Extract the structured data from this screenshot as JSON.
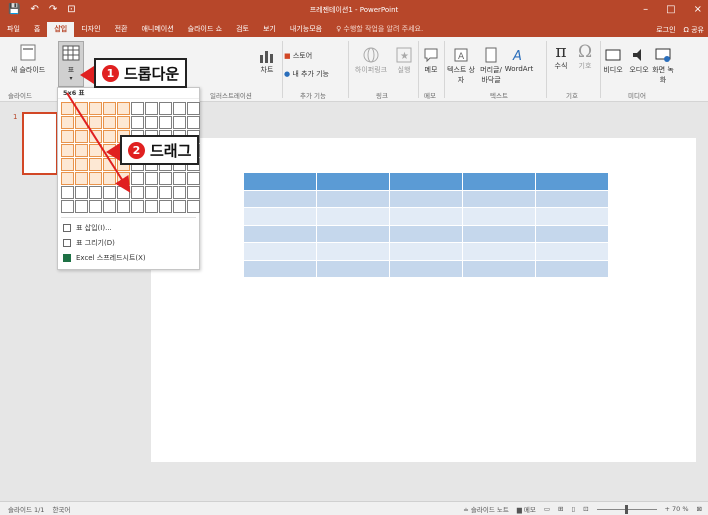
{
  "window": {
    "title": "프레젠테이션1 - PowerPoint",
    "min": "–",
    "max": "□",
    "close": "×"
  },
  "qat": [
    "💾",
    "↶",
    "↷",
    "⊡"
  ],
  "tabs": [
    {
      "label": "파일",
      "active": false
    },
    {
      "label": "홈",
      "active": false
    },
    {
      "label": "삽입",
      "active": true
    },
    {
      "label": "디자인",
      "active": false
    },
    {
      "label": "전환",
      "active": false
    },
    {
      "label": "애니메이션",
      "active": false
    },
    {
      "label": "슬라이드 쇼",
      "active": false
    },
    {
      "label": "검토",
      "active": false
    },
    {
      "label": "보기",
      "active": false
    },
    {
      "label": "내기능모음",
      "active": false
    }
  ],
  "tell_me": "♀ 수행할 작업을 알려 주세요.",
  "account": {
    "login": "로그인",
    "share": "Ω 공유"
  },
  "ribbon": {
    "new_slide": "새 슬라이드",
    "table": "표",
    "chart": "차트",
    "store": "스토어",
    "my_addins": "내 추가 기능",
    "hyperlink": "하이퍼링크",
    "action": "실행",
    "memo": "메모",
    "textbox": "텍스트 상자",
    "header_footer": "머리글/ 바닥글",
    "wordart": "WordArt",
    "equation": "수식",
    "symbol": "기호",
    "video": "비디오",
    "audio": "오디오",
    "screen_record": "화면 녹화",
    "groups": {
      "slide": "슬라이드",
      "illust": "일러스트레이션",
      "addins": "추가 기능",
      "links": "링크",
      "memo": "메모",
      "text": "텍스트",
      "symbols": "기호",
      "media": "미디어"
    }
  },
  "dropdown": {
    "header": "5x6 표",
    "insert_table": "표 삽입(I)...",
    "draw_table": "표 그리기(D)",
    "excel_sheet": "Excel 스프레드시트(X)"
  },
  "callouts": {
    "one": {
      "num": "1",
      "text": "드롭다운"
    },
    "two": {
      "num": "2",
      "text": "드래그"
    }
  },
  "slide_panel": {
    "number": "1"
  },
  "status": {
    "slide": "슬라이드 1/1",
    "lang": "한국어",
    "notes": "≐ 슬라이드 노트",
    "comments": "▆ 메모",
    "zoom": "+ 70 %"
  },
  "colors": {
    "accent": "#b7472a",
    "table_header": "#5b9bd5"
  }
}
